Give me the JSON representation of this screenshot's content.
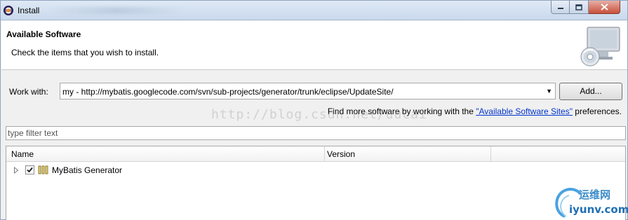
{
  "window": {
    "title": "Install",
    "icon": "eclipse-icon",
    "caption_buttons": {
      "minimize": "minimize-icon",
      "maximize": "maximize-icon",
      "close": "close-icon"
    }
  },
  "header": {
    "title": "Available Software",
    "description": "Check the items that you wish to install.",
    "banner_icon": "install-cd-monitor-icon"
  },
  "work_with": {
    "label": "Work with:",
    "value": "my - http://mybatis.googlecode.com/svn/sub-projects/generator/trunk/eclipse/UpdateSite/",
    "add_button": "Add..."
  },
  "more_software": {
    "prefix": "Find more software by working with the",
    "link": "\"Available Software Sites\"",
    "suffix": "preferences."
  },
  "watermark": "http://blog.csdn.net/uucai",
  "filter": {
    "placeholder": "type filter text"
  },
  "table": {
    "columns": [
      "Name",
      "Version",
      ""
    ],
    "rows": [
      {
        "name": "MyBatis Generator",
        "version": "",
        "checked": true,
        "expanded": false
      }
    ]
  },
  "logo": {
    "cn": "运维网",
    "en": "iyunv.com"
  },
  "colors": {
    "link": "#0033cc",
    "titlebar": "#c9d9ec",
    "close_button": "#c8503c"
  }
}
